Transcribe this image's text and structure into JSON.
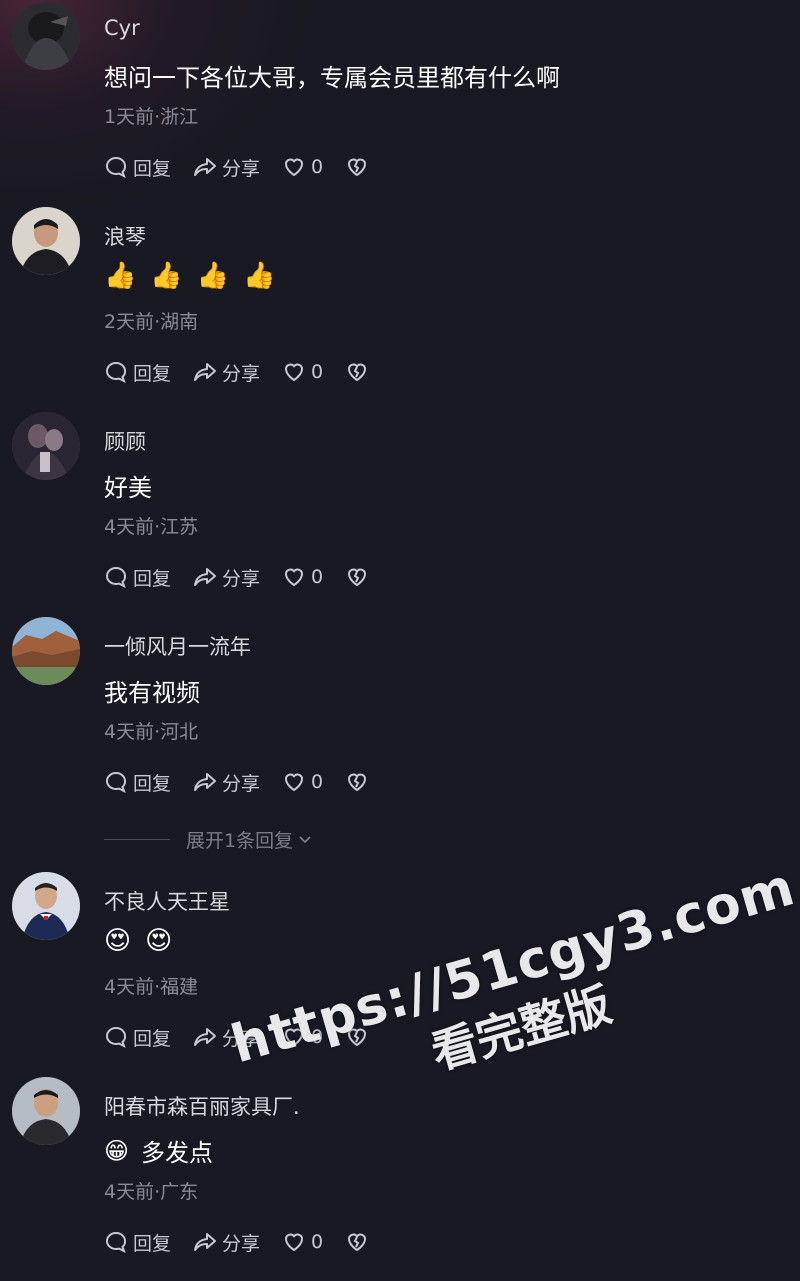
{
  "comments": [
    {
      "username": "Cyr",
      "text": "想问一下各位大哥，专属会员里都有什么啊",
      "emojis": [],
      "time_location": "1天前·浙江",
      "avatar": "avatar-dark-hooded"
    },
    {
      "username": "浪琴",
      "text": "",
      "emojis": [
        "👍",
        "👍",
        "👍",
        "👍"
      ],
      "time_location": "2天前·湖南",
      "avatar": "avatar-man-portrait"
    },
    {
      "username": "顾顾",
      "text": "好美",
      "emojis": [],
      "time_location": "4天前·江苏",
      "avatar": "avatar-dark-couple"
    },
    {
      "username": "一倾风月一流年",
      "text": "我有视频",
      "emojis": [],
      "time_location": "4天前·河北",
      "avatar": "avatar-landscape-cliffs"
    },
    {
      "username": "不良人天王星",
      "text": "",
      "emojis": [
        "😍",
        "😍"
      ],
      "time_location": "4天前·福建",
      "avatar": "avatar-man-suit"
    },
    {
      "username": "阳春市森百丽家具厂.",
      "text": "多发点",
      "emojis": [
        "😁"
      ],
      "time_location": "4天前·广东",
      "avatar": "avatar-man-portrait-2"
    }
  ],
  "actions": {
    "reply_label": "回复",
    "share_label": "分享",
    "like_count": "0"
  },
  "expand_replies": "展开1条回复",
  "watermark": {
    "line1": "https://51cgy3.com",
    "line2": "看完整版"
  },
  "colors": {
    "background": "#181922",
    "username": "#d8d8de",
    "meta": "#8a8b94",
    "actions": "#c8c8d0"
  }
}
